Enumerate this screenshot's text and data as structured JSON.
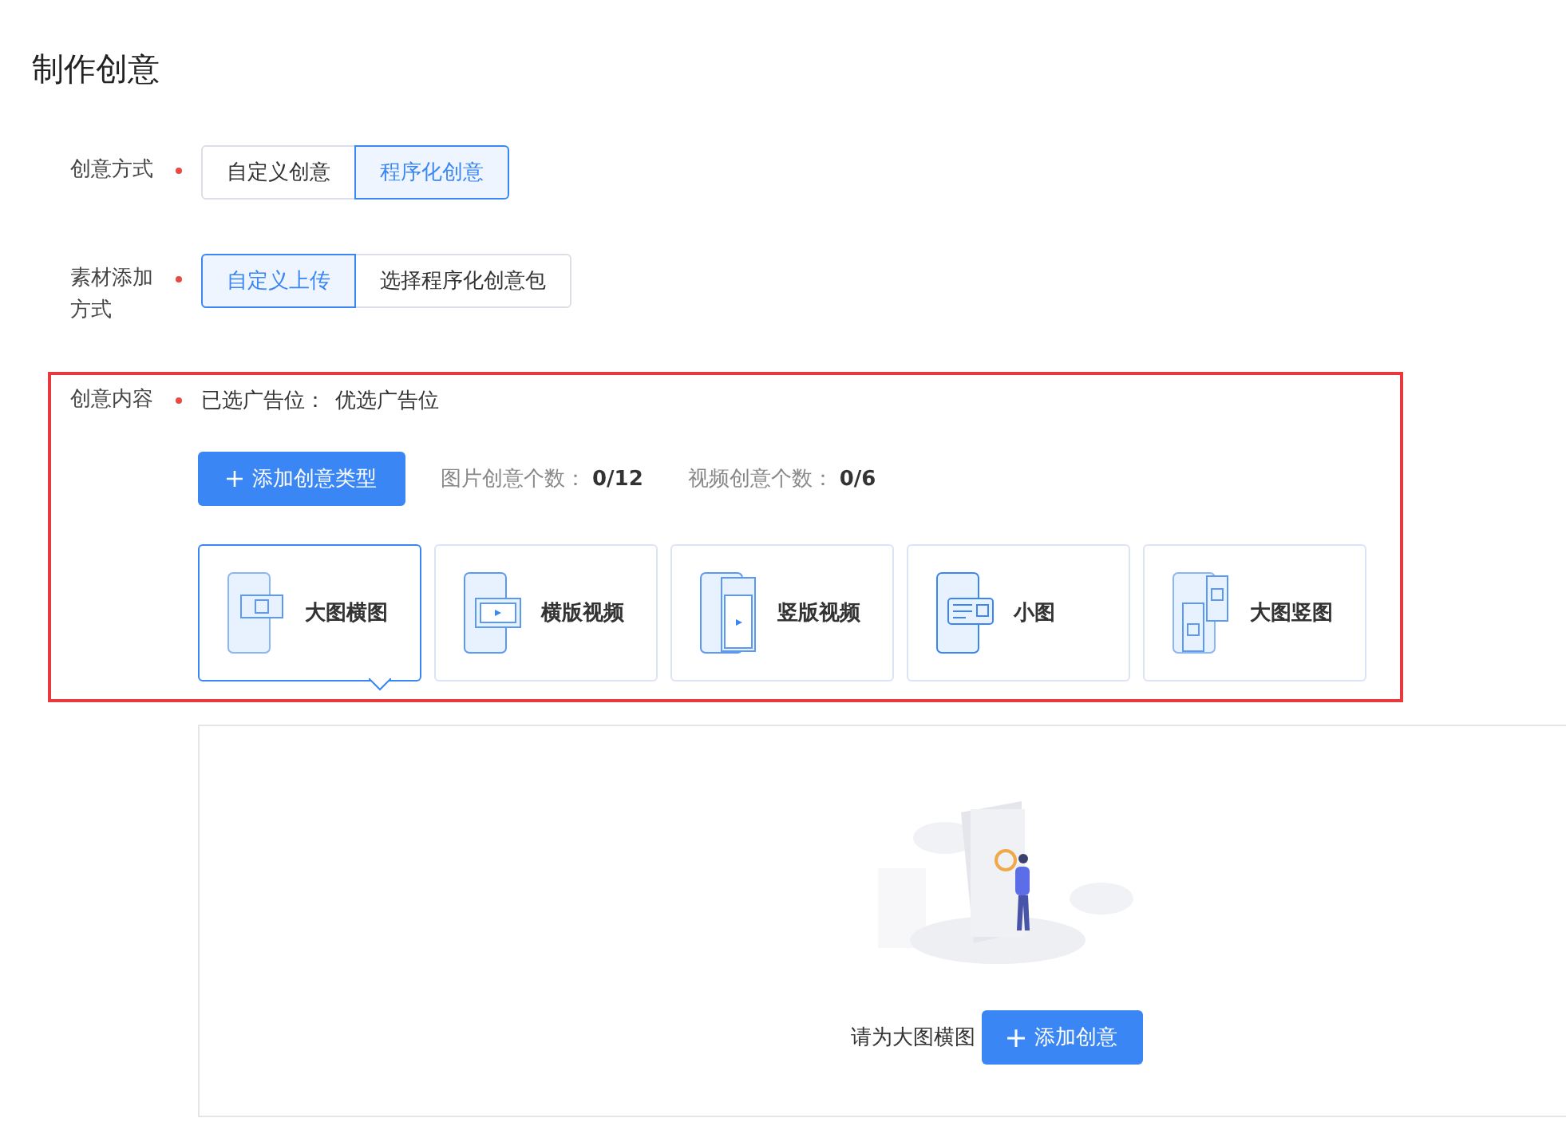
{
  "page_title": "制作创意",
  "creative_mode": {
    "label": "创意方式",
    "required": true,
    "options": [
      {
        "label": "自定义创意",
        "selected": false
      },
      {
        "label": "程序化创意",
        "selected": true
      }
    ]
  },
  "material_source": {
    "label": "素材添加方式",
    "required": true,
    "options": [
      {
        "label": "自定义上传",
        "selected": true
      },
      {
        "label": "选择程序化创意包",
        "selected": false
      }
    ]
  },
  "creative_content": {
    "label": "创意内容",
    "required": true,
    "placement_label": "已选广告位：",
    "placement_value": "优选广告位",
    "add_type_button": "添加创意类型",
    "image_count_label": "图片创意个数：",
    "image_count": "0/12",
    "video_count_label": "视频创意个数：",
    "video_count": "0/6",
    "types": [
      {
        "kind": "large-landscape",
        "label": "大图横图",
        "selected": true
      },
      {
        "kind": "landscape-video",
        "label": "横版视频",
        "selected": false
      },
      {
        "kind": "portrait-video",
        "label": "竖版视频",
        "selected": false
      },
      {
        "kind": "small-image",
        "label": "小图",
        "selected": false
      },
      {
        "kind": "large-portrait",
        "label": "大图竖图",
        "selected": false
      }
    ]
  },
  "empty_state": {
    "prompt": "请为大图横图",
    "add_button": "添加创意"
  }
}
